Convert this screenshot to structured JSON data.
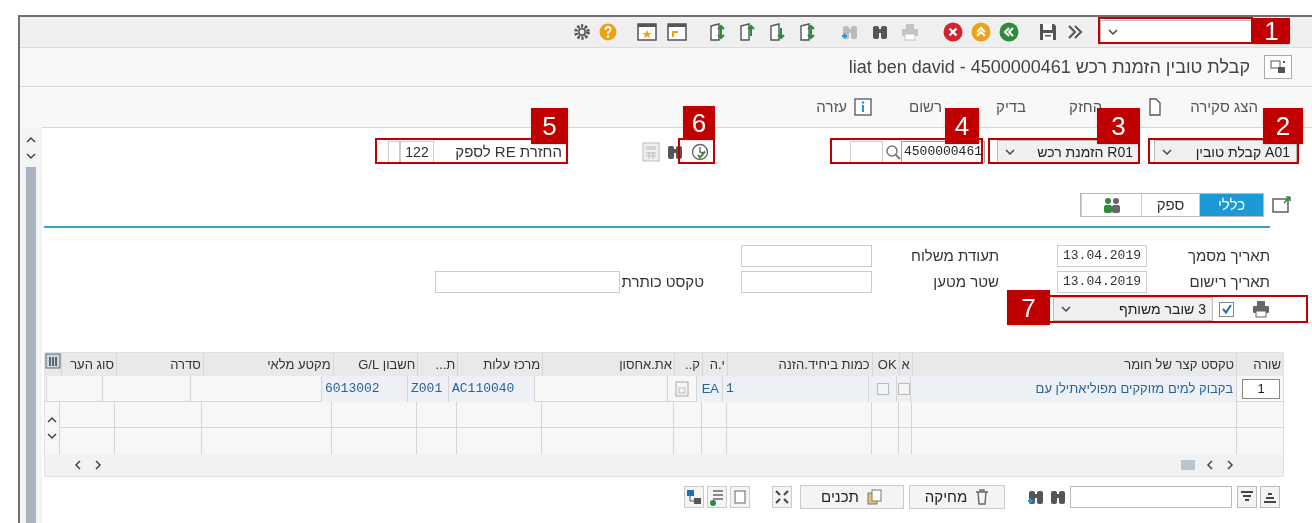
{
  "title": "קבלת טובין הזמנת רכש 4500000461 - liat ben david",
  "menu": [
    {
      "label": "הצג סקירה",
      "kind": "text"
    },
    {
      "label": "החזק",
      "kind": "icon_text"
    },
    {
      "label": "בדיק",
      "kind": "text"
    },
    {
      "label": "רשום",
      "kind": "text"
    },
    {
      "label": "עזרה",
      "kind": "icon_text"
    }
  ],
  "header": {
    "transaction": "A01 קבלת טובין",
    "reference_type": "R01 הזמנת רכש",
    "document_number": "4500000461",
    "movement_label": "החזרת RE לספק",
    "movement_type": "122"
  },
  "tabs": [
    {
      "kind": "text",
      "label": "כללי",
      "selected": true
    },
    {
      "kind": "text",
      "label": "ספק",
      "selected": false
    },
    {
      "kind": "icon",
      "selected": false
    }
  ],
  "fields": [
    {
      "label": "תאריך מסמך",
      "value": "13.04.2019"
    },
    {
      "label": "תעודת משלוח"
    },
    {
      "label": "תאריך רישום",
      "value": "13.04.2019"
    },
    {
      "label": "שטר מטען"
    },
    {
      "label": "טקסט כותרת"
    }
  ],
  "print": {
    "checked": true,
    "slip": "3 שובר משותף"
  },
  "table": {
    "columns": [
      "שורה",
      "טקסט קצר של חומר",
      "א",
      "OK",
      "כמות ביחיד.הזנה",
      "י.ה",
      "ק..",
      "את.אחסון",
      "מרכז עלות",
      "ת...",
      "חשבון G/L",
      "מקטע מלאי",
      "סדרה",
      "סוג הער"
    ],
    "rows": [
      {
        "line": "1",
        "material_text": "בקבוק למים מזוקקים מפוליאתילן עם",
        "flag_checked": false,
        "ok_checked": false,
        "quantity": "1",
        "unit": "EA",
        "cost_center": "AC110040",
        "col_10": "Z001",
        "gl_account": "6013002"
      }
    ]
  },
  "buttons": [
    "מחיקה",
    "תכנים"
  ],
  "callouts": [
    {
      "number": "1"
    },
    {
      "number": "2"
    },
    {
      "number": "3"
    },
    {
      "number": "4"
    },
    {
      "number": "6"
    },
    {
      "number": "5"
    },
    {
      "number": "7"
    }
  ]
}
